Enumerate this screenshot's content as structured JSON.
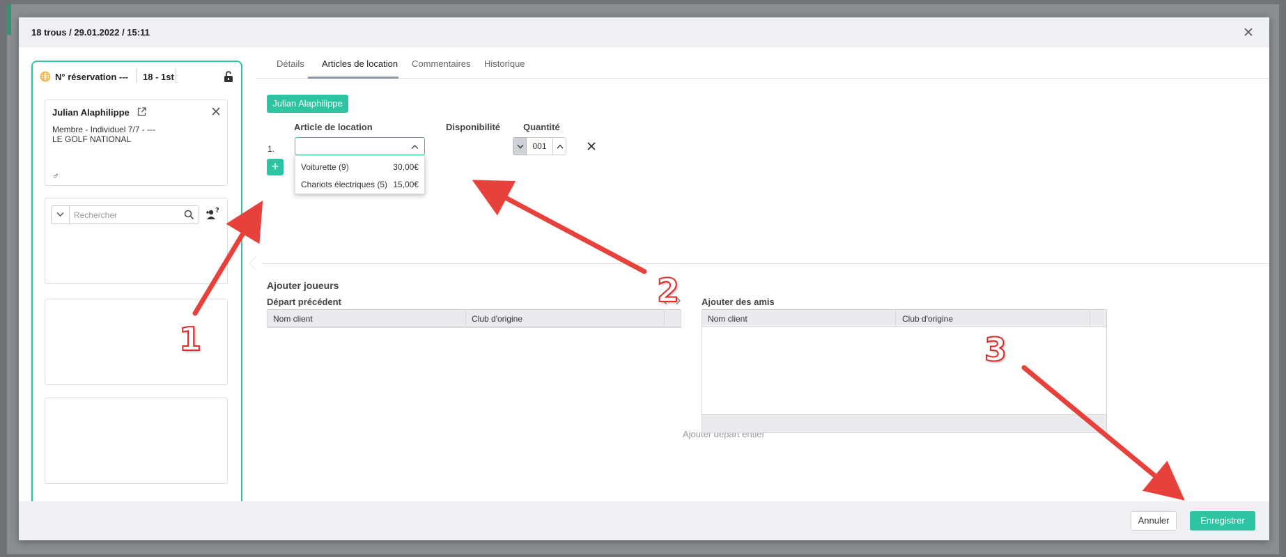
{
  "modal": {
    "title": "18 trous / 29.01.2022 / 15:11"
  },
  "left_panel": {
    "reservation_label": "N° réservation ---",
    "hole_label": "18 - 1st",
    "player_card": {
      "name": "Julian Alaphilippe",
      "member_line": "Membre - Individuel 7/7 - ---",
      "club": "LE GOLF NATIONAL",
      "gender_symbol": "♂"
    },
    "search": {
      "placeholder": "Rechercher"
    }
  },
  "tabs": [
    {
      "label": "Détails"
    },
    {
      "label": "Articles de location"
    },
    {
      "label": "Commentaires"
    },
    {
      "label": "Historique"
    }
  ],
  "rental": {
    "player_button": "Julian Alaphilippe",
    "col_article": "Article de location",
    "col_availability": "Disponibilité",
    "col_quantity": "Quantité",
    "row_number": "1.",
    "quantity_value": "001",
    "add_symbol": "+",
    "dropdown_options": [
      {
        "name": "Voiturette (9)",
        "price": "30,00€"
      },
      {
        "name": "Chariots électriques (5)",
        "price": "15,00€"
      }
    ]
  },
  "add_players": {
    "title": "Ajouter joueurs",
    "previous_departure": {
      "title": "Départ précédent",
      "columns": [
        "Nom client",
        "Club d'origine"
      ],
      "add_all_label": "Ajouter départ entier"
    },
    "friends": {
      "title": "Ajouter des amis",
      "columns": [
        "Nom client",
        "Club d'origine"
      ]
    }
  },
  "footer": {
    "cancel_label": "Annuler",
    "save_label": "Enregistrer"
  },
  "annotations": {
    "numbers": [
      "1",
      "2",
      "3"
    ],
    "arrow_color": "#e8413c"
  },
  "colors": {
    "accent": "#2ec4a1",
    "globe": "#f0a830"
  }
}
